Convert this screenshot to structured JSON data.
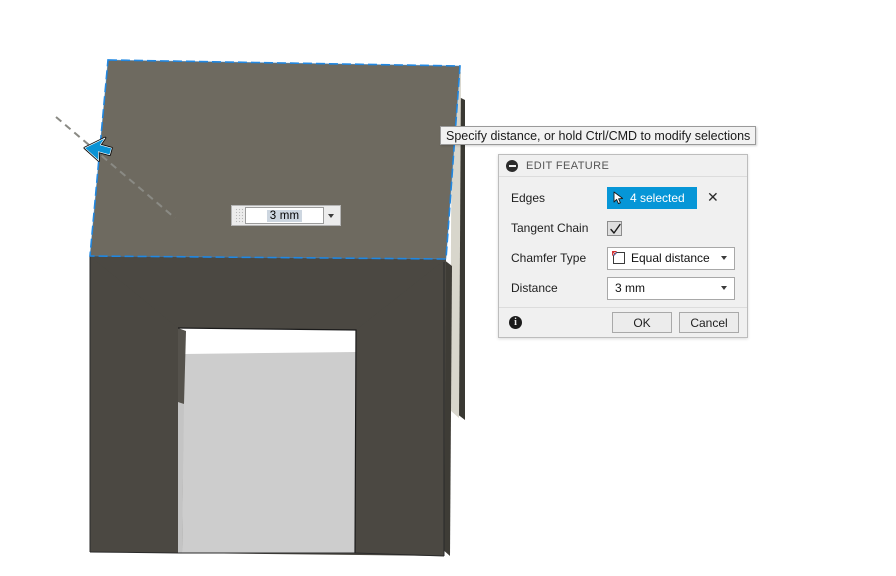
{
  "app": {
    "tooltip": "Specify distance, or hold Ctrl/CMD to modify selections"
  },
  "canvas_input": {
    "name": "distance-manipulator",
    "value": "3 mm",
    "grip_icon": "drag-grip-icon",
    "dropdown_icon": "chevron-down-icon"
  },
  "viewport": {
    "name": "3d-viewport",
    "model_name": "chamfered-bracket-body",
    "colors": {
      "top_face": "#6e6a60",
      "front_face": "#4b4842",
      "inner_face": "#cdcdcd",
      "chamfer_face": "#d8d6cc",
      "side_dark": "#3a3933",
      "selection_blue": "#1a84e0",
      "background": "#ffffff"
    },
    "cursor": {
      "name": "arrow-cursor",
      "color": "#0a93d5",
      "drag_line": "dashed-drag-line"
    }
  },
  "dialog": {
    "name": "edit-feature-dialog",
    "header": {
      "title": "EDIT FEATURE",
      "collapse_icon": "collapse-minus-icon"
    },
    "rows": [
      {
        "label": "Edges",
        "type": "selection",
        "value": "4 selected",
        "icon": "selection-cursor-icon",
        "clear_label": "✕",
        "accent": "#0696d7"
      },
      {
        "label": "Tangent Chain",
        "type": "checkbox",
        "checked": true
      },
      {
        "label": "Chamfer Type",
        "type": "combobox",
        "value": "Equal distance",
        "icon": "chamfer-equal-distance-icon"
      },
      {
        "label": "Distance",
        "type": "combobox",
        "value": "3 mm"
      }
    ],
    "footer": {
      "info_icon": "info-icon",
      "info_label": "i",
      "ok_label": "OK",
      "cancel_label": "Cancel"
    }
  }
}
